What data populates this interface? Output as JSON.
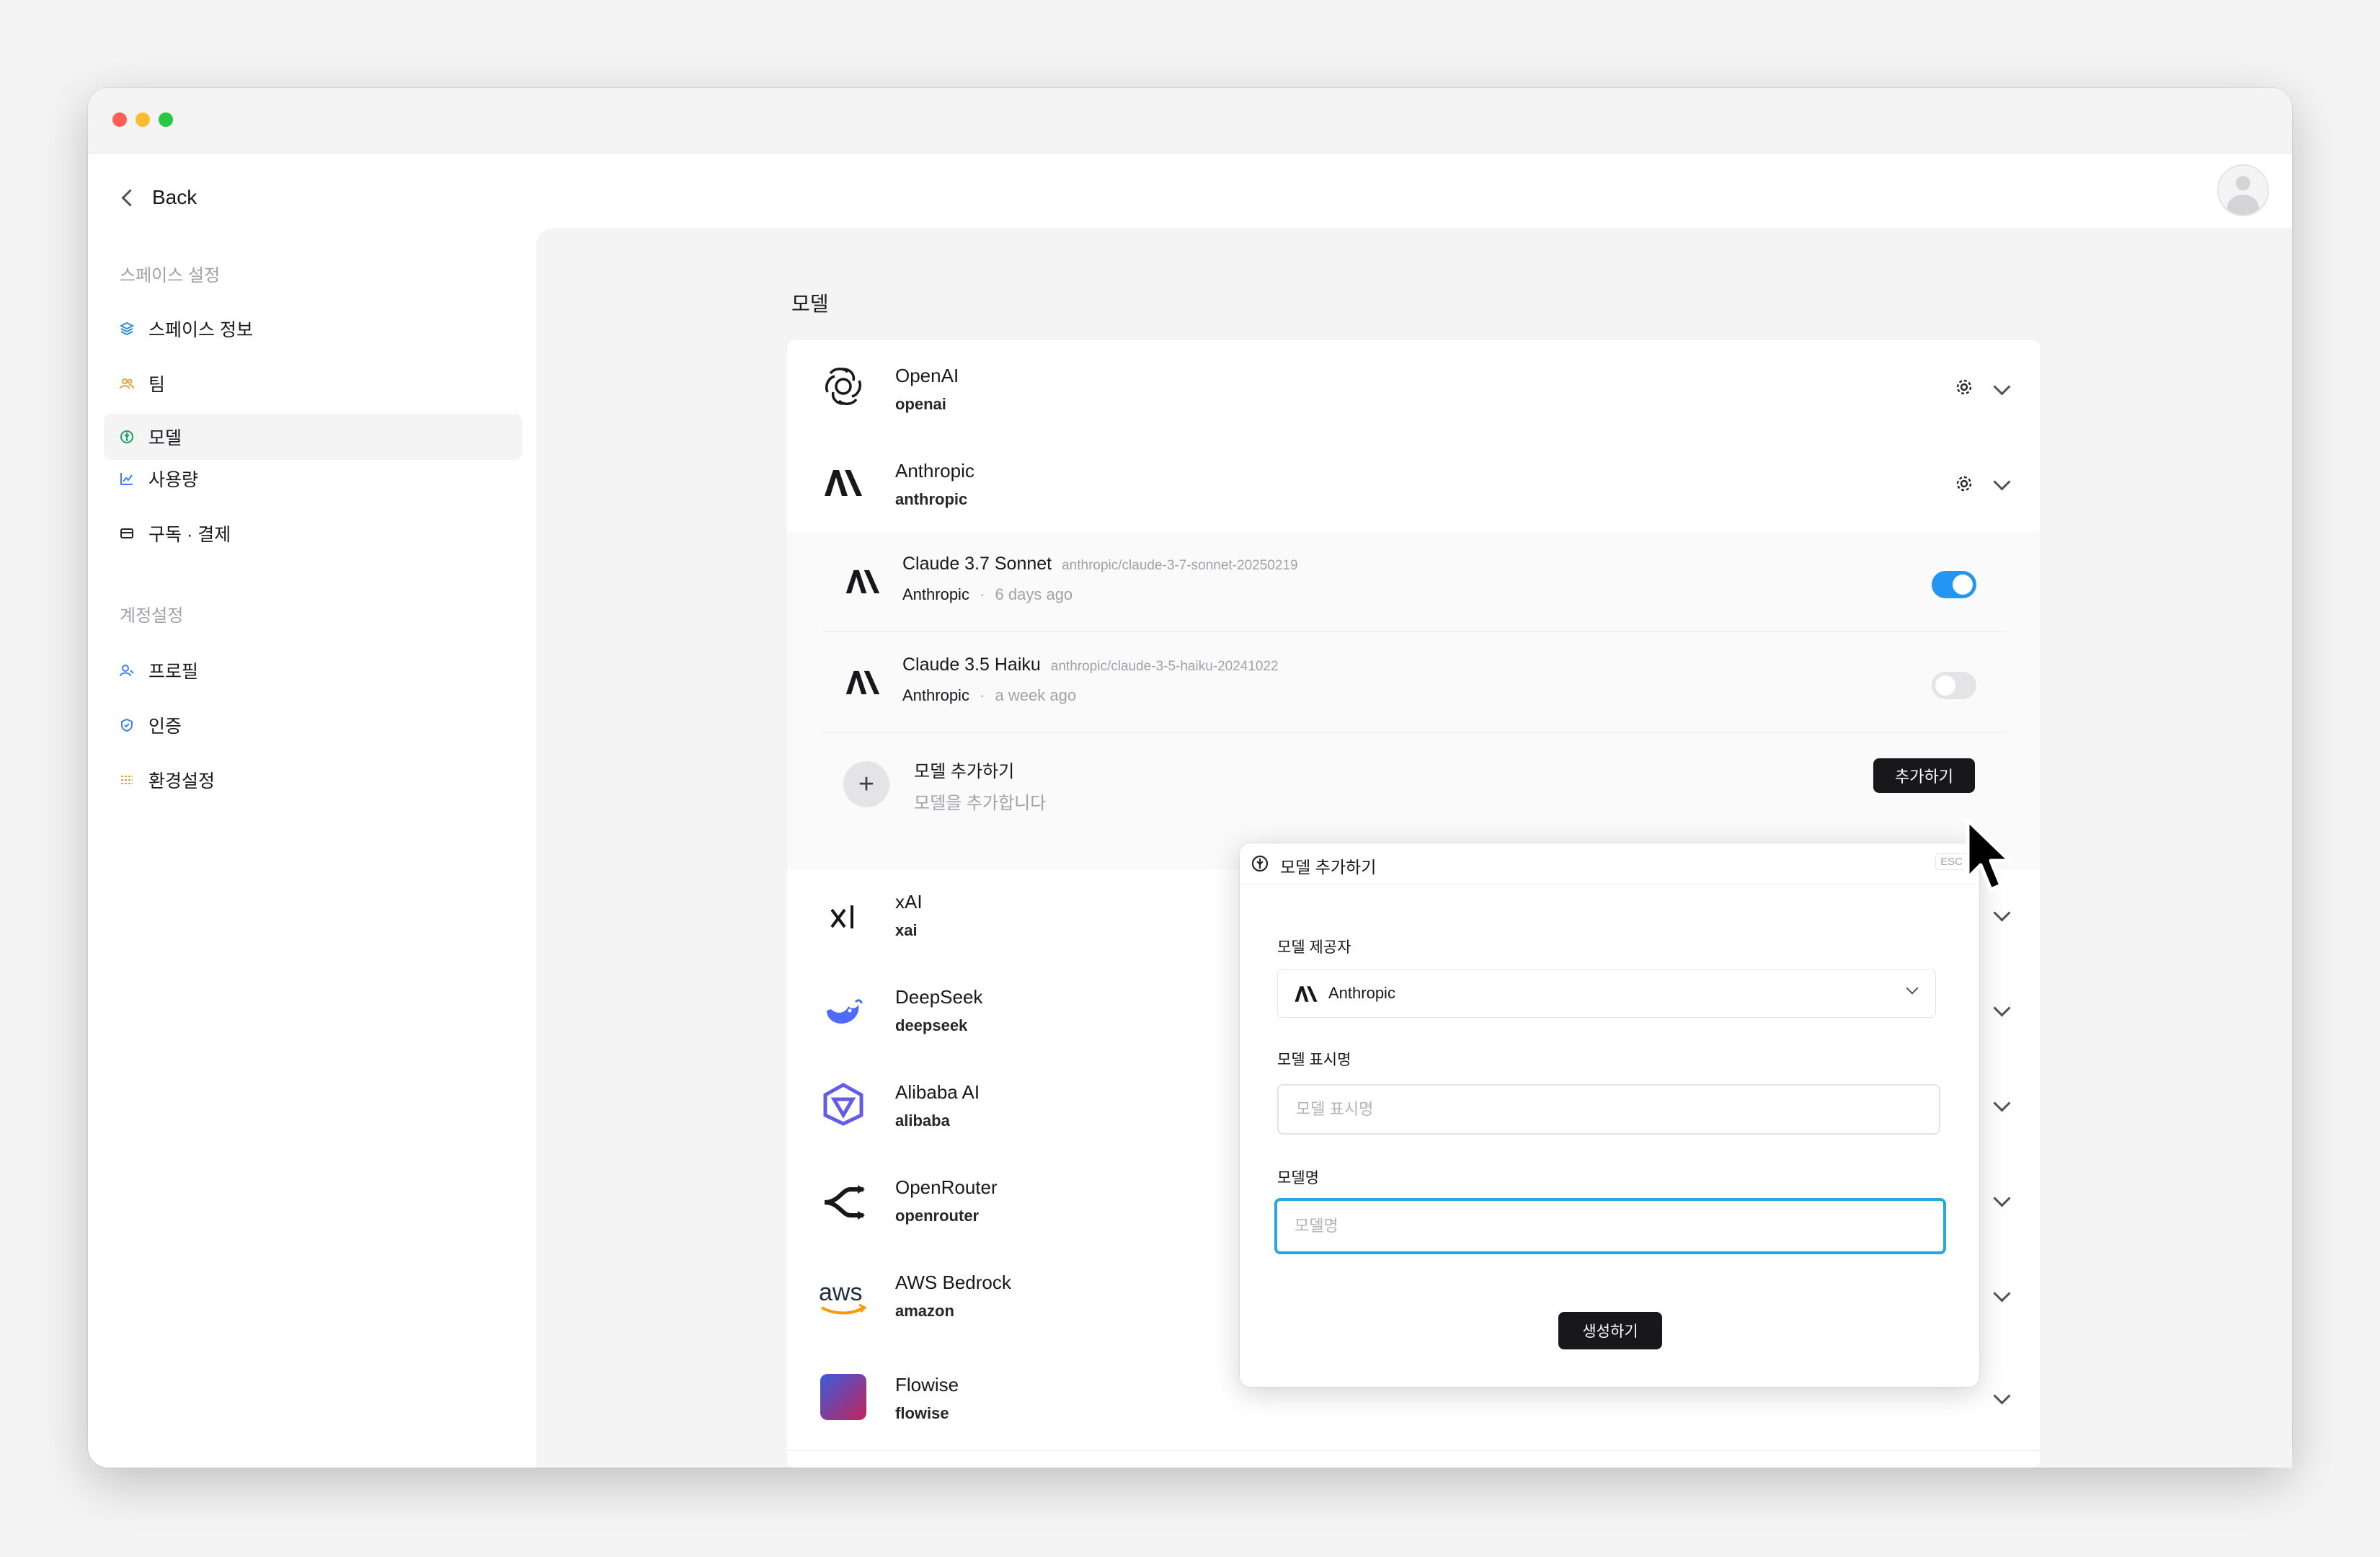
{
  "sidebar": {
    "back_label": "Back",
    "space_section_label": "스페이스 설정",
    "space_items": [
      {
        "label": "스페이스 정보",
        "icon": "layers-icon"
      },
      {
        "label": "팀",
        "icon": "users-icon"
      },
      {
        "label": "모델",
        "icon": "model-icon",
        "active": true
      },
      {
        "label": "사용량",
        "icon": "chart-icon"
      },
      {
        "label": "구독 · 결제",
        "icon": "card-icon"
      }
    ],
    "account_section_label": "계정설정",
    "account_items": [
      {
        "label": "프로필",
        "icon": "profile-icon"
      },
      {
        "label": "인증",
        "icon": "shield-icon"
      },
      {
        "label": "환경설정",
        "icon": "sliders-icon"
      }
    ]
  },
  "main": {
    "title": "모델",
    "providers": [
      {
        "name": "OpenAI",
        "slug": "openai"
      },
      {
        "name": "Anthropic",
        "slug": "anthropic"
      },
      {
        "name": "xAI",
        "slug": "xai"
      },
      {
        "name": "DeepSeek",
        "slug": "deepseek"
      },
      {
        "name": "Alibaba AI",
        "slug": "alibaba"
      },
      {
        "name": "OpenRouter",
        "slug": "openrouter"
      },
      {
        "name": "AWS Bedrock",
        "slug": "amazon"
      },
      {
        "name": "Flowise",
        "slug": "flowise"
      }
    ],
    "models": [
      {
        "name": "Claude 3.7 Sonnet",
        "id": "anthropic/claude-3-7-sonnet-20250219",
        "provider": "Anthropic",
        "separator": "·",
        "ago": "6 days ago",
        "enabled": true
      },
      {
        "name": "Claude 3.5 Haiku",
        "id": "anthropic/claude-3-5-haiku-20241022",
        "provider": "Anthropic",
        "separator": "·",
        "ago": "a week ago",
        "enabled": false
      }
    ],
    "add_model": {
      "title": "모델 추가하기",
      "description": "모델을 추가합니다",
      "button": "추가하기"
    }
  },
  "popup": {
    "title": "모델 추가하기",
    "esc": "ESC",
    "provider_label": "모델 제공자",
    "provider_value": "Anthropic",
    "display_name_label": "모델 표시명",
    "display_name_placeholder": "모델 표시명",
    "display_name_value": "",
    "model_name_label": "모델명",
    "model_name_placeholder": "모델명",
    "model_name_value": "",
    "submit": "생성하기"
  },
  "colors": {
    "accent": "#2196f3",
    "focus_ring": "#29a7e1",
    "primary_button": "#18181b"
  }
}
